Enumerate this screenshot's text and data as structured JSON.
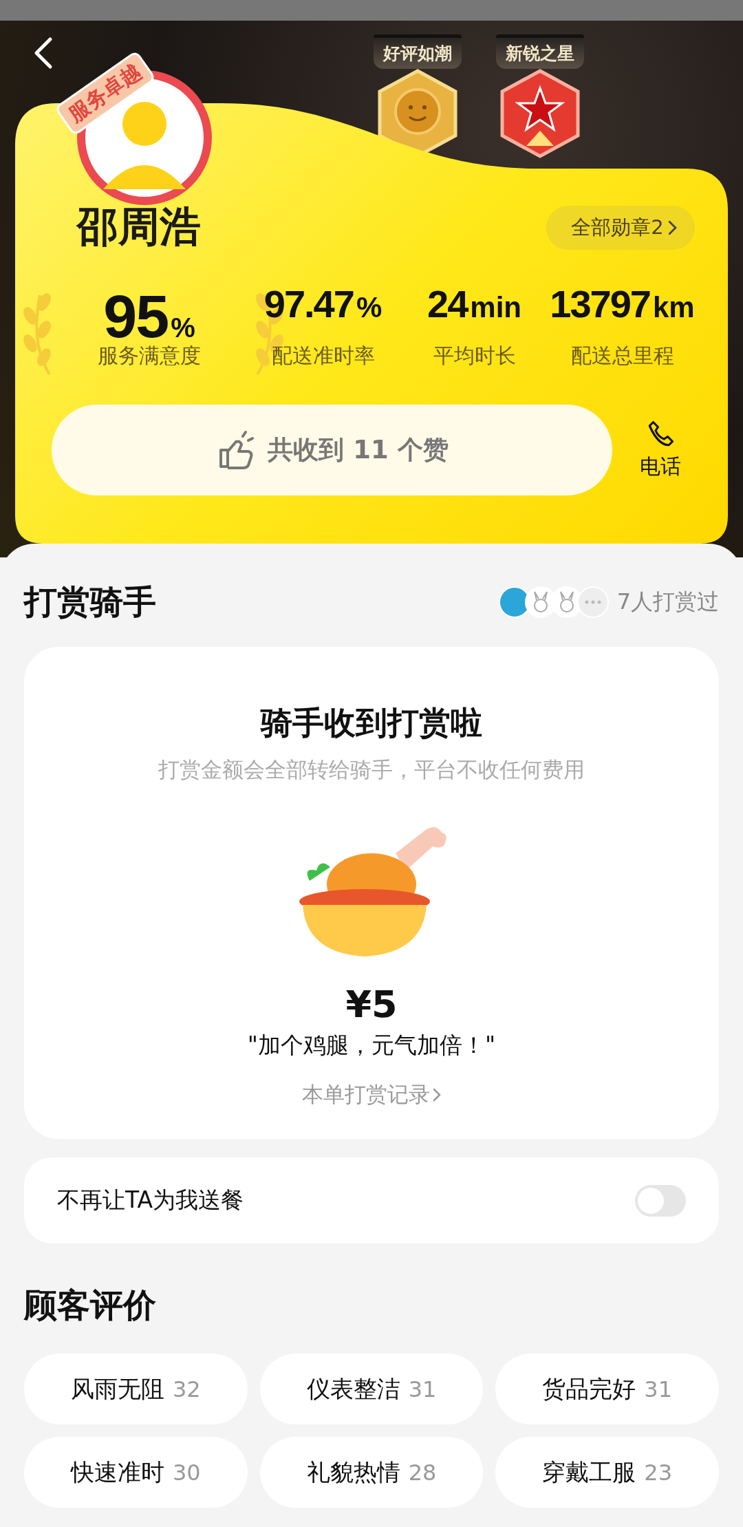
{
  "header": {
    "ribbon": "服务卓越",
    "badges": [
      {
        "label": "好评如潮",
        "kind": "smile"
      },
      {
        "label": "新锐之星",
        "kind": "star"
      }
    ],
    "name": "邵周浩",
    "all_badges": "全部勋章2",
    "stats": [
      {
        "value": "95",
        "unit": "%",
        "label": "服务满意度",
        "laurels": true
      },
      {
        "value": "97.47",
        "unit": "%",
        "label": "配送准时率",
        "laurels": false
      },
      {
        "value": "24",
        "unit": "min",
        "label": "平均时长",
        "laurels": false
      },
      {
        "value": "13797",
        "unit": "km",
        "label": "配送总里程",
        "laurels": false
      }
    ],
    "likes": "共收到 11 个赞",
    "phone": "电话"
  },
  "tip": {
    "title": "打赏骑手",
    "rewarders": [
      {
        "kind": "photo"
      },
      {
        "kind": "rabbit"
      },
      {
        "kind": "rabbit"
      },
      {
        "kind": "more"
      }
    ],
    "rewarder_count": "7人打赏过",
    "card_title": "骑手收到打赏啦",
    "card_subtitle": "打赏金额会全部转给骑手，平台不收任何费用",
    "amount": "¥5",
    "message": "\"加个鸡腿，元气加倍！\"",
    "record_link": "本单打赏记录"
  },
  "block": {
    "label": "不再让TA为我送餐",
    "on": false
  },
  "reviews": {
    "title": "顾客评价",
    "tags": [
      {
        "label": "风雨无阻",
        "count": "32"
      },
      {
        "label": "仪表整洁",
        "count": "31"
      },
      {
        "label": "货品完好",
        "count": "31"
      },
      {
        "label": "快速准时",
        "count": "30"
      },
      {
        "label": "礼貌热情",
        "count": "28"
      },
      {
        "label": "穿戴工服",
        "count": "23"
      }
    ]
  }
}
